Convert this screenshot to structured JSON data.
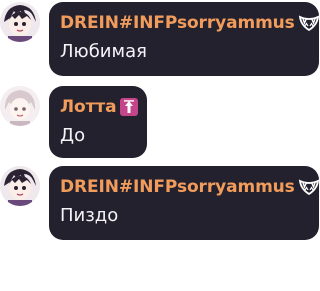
{
  "messages": [
    {
      "author": "DREIN#INFPsorryammus",
      "author_color": "#f29c5c",
      "badge_icon": "fangs-icon",
      "text": "Любимая"
    },
    {
      "author": "Лотта",
      "author_color": "#f29c5c",
      "badge_icon": "up-arrow-badge-icon",
      "text": "До"
    },
    {
      "author": "DREIN#INFPsorryammus",
      "author_color": "#f29c5c",
      "badge_icon": "fangs-icon",
      "text": "Пиздо"
    }
  ]
}
